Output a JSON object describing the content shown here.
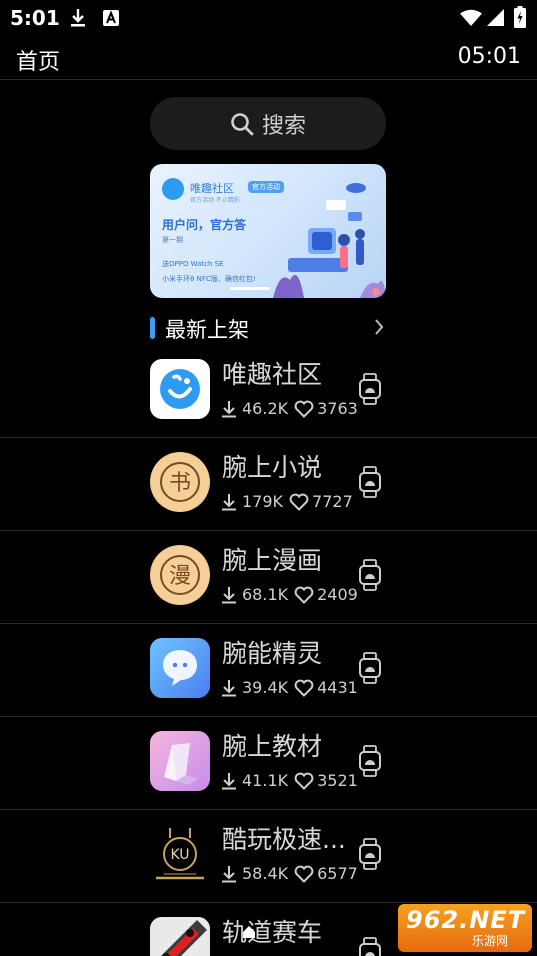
{
  "status_bar": {
    "time": "5:01",
    "icons": [
      "download-icon",
      "font-icon",
      "wifi-icon",
      "signal-icon",
      "battery-icon"
    ]
  },
  "header": {
    "title": "首页",
    "clock": "05:01"
  },
  "search": {
    "label": "搜索",
    "icon": "search-icon"
  },
  "banner": {
    "brand": "唯趣社区",
    "tag": "官方活动",
    "subtitle": "官方活动 不止精彩",
    "headline": "用户问，官方答",
    "issue": "第一期",
    "line1": "送OPPO Watch SE",
    "line2": "小米手环8 NFC版、确信红包!"
  },
  "section": {
    "title": "最新上架",
    "accent": "#3d9cf5"
  },
  "apps": [
    {
      "name": "唯趣社区",
      "downloads": "46.2K",
      "likes": "3763",
      "icon": "weiqu-app-icon"
    },
    {
      "name": "腕上小说",
      "downloads": "179K",
      "likes": "7727",
      "icon": "book-app-icon",
      "glyph": "书"
    },
    {
      "name": "腕上漫画",
      "downloads": "68.1K",
      "likes": "2409",
      "icon": "comic-app-icon",
      "glyph": "漫"
    },
    {
      "name": "腕能精灵",
      "downloads": "39.4K",
      "likes": "4431",
      "icon": "sprite-app-icon"
    },
    {
      "name": "腕上教材",
      "downloads": "41.1K",
      "likes": "3521",
      "icon": "textbook-app-icon"
    },
    {
      "name": "酷玩极速...",
      "downloads": "58.4K",
      "likes": "6577",
      "icon": "ku-app-icon",
      "glyph": "KU"
    },
    {
      "name": "轨道赛车",
      "downloads": "",
      "likes": "",
      "icon": "racing-app-icon"
    }
  ],
  "watermark": {
    "main": "962.NET",
    "sub": "乐游网"
  }
}
